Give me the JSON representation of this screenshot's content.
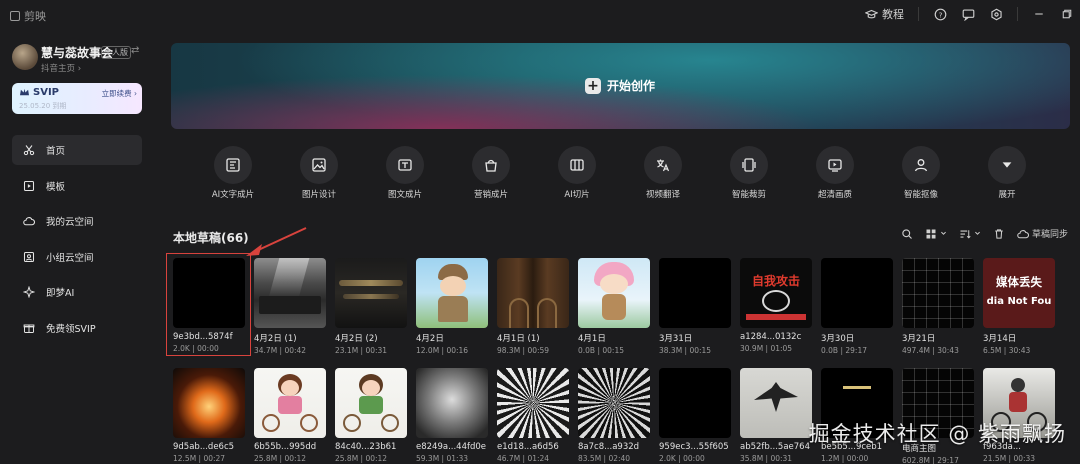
{
  "titlebar": {
    "app_name": "剪映",
    "tutorial_label": "教程"
  },
  "profile": {
    "name": "慧与蕊故事会",
    "badge": "个人版",
    "sub": "抖音主页 ›"
  },
  "svip": {
    "label": "SVIP",
    "cta": "立即续费 ›",
    "sub": "25.05.20 到期"
  },
  "nav": [
    {
      "label": "首页",
      "icon": "scissors-icon",
      "active": true
    },
    {
      "label": "模板",
      "icon": "template-icon",
      "active": false
    },
    {
      "label": "我的云空间",
      "icon": "cloud-space-icon",
      "active": false
    },
    {
      "label": "小组云空间",
      "icon": "team-space-icon",
      "active": false
    },
    {
      "label": "即梦AI",
      "icon": "sparkle-icon",
      "active": false
    },
    {
      "label": "免费领SVIP",
      "icon": "gift-icon",
      "active": false
    }
  ],
  "banner": {
    "create_label": "开始创作"
  },
  "tools": [
    {
      "label": "AI文字成片",
      "icon": "ai-text-video-icon"
    },
    {
      "label": "图片设计",
      "icon": "image-design-icon"
    },
    {
      "label": "图文成片",
      "icon": "image-text-video-icon"
    },
    {
      "label": "营销成片",
      "icon": "marketing-video-icon"
    },
    {
      "label": "AI切片",
      "icon": "ai-slice-icon"
    },
    {
      "label": "视频翻译",
      "icon": "translate-icon"
    },
    {
      "label": "智能裁剪",
      "icon": "smart-crop-icon"
    },
    {
      "label": "超清画质",
      "icon": "hd-quality-icon"
    },
    {
      "label": "智能抠像",
      "icon": "smart-matting-icon"
    },
    {
      "label": "展开",
      "icon": "expand-icon"
    }
  ],
  "drafts": {
    "title": "本地草稿(66)",
    "sync_label": "草稿同步",
    "row1": [
      {
        "name": "9e3bd...5874f",
        "meta": "2.0K | 00:00",
        "thumb": "black"
      },
      {
        "name": "4月2日 (1)",
        "meta": "34.7M | 00:42",
        "thumb": "ink-city"
      },
      {
        "name": "4月2日 (2)",
        "meta": "23.1M | 00:31",
        "thumb": "ink-mountain"
      },
      {
        "name": "4月2日",
        "meta": "12.0M | 00:16",
        "thumb": "cartoon-girl"
      },
      {
        "name": "4月1日 (1)",
        "meta": "98.3M | 00:59",
        "thumb": "doors"
      },
      {
        "name": "4月1日",
        "meta": "0.0B | 00:15",
        "thumb": "pink-girl"
      },
      {
        "name": "3月31日",
        "meta": "38.3M | 00:15",
        "thumb": "black"
      },
      {
        "name": "a1284...0132c",
        "meta": "30.9M | 01:05",
        "thumb": "poster",
        "text": "自我攻击"
      },
      {
        "name": "3月30日",
        "meta": "0.0B | 29:17",
        "thumb": "black"
      },
      {
        "name": "3月21日",
        "meta": "497.4M | 30:43",
        "thumb": "grid-dark"
      },
      {
        "name": "3月14日",
        "meta": "6.5M | 30:43",
        "thumb": "red-title",
        "text": "媒体丢失",
        "text2": "dia Not Fou"
      }
    ],
    "row2": [
      {
        "name": "9d5ab...de6c5",
        "meta": "12.5M | 00:27",
        "thumb": "fire"
      },
      {
        "name": "6b55b...995dd",
        "meta": "25.8M | 00:12",
        "thumb": "kid-bike"
      },
      {
        "name": "84c40...23b61",
        "meta": "25.8M | 00:12",
        "thumb": "kid-bike-2"
      },
      {
        "name": "e8249a...44fd0e",
        "meta": "59.3M | 01:33",
        "thumb": "blur-grey"
      },
      {
        "name": "e1d18...a6d56",
        "meta": "46.7M | 01:24",
        "thumb": "radial"
      },
      {
        "name": "8a7c8...a932d",
        "meta": "83.5M | 02:40",
        "thumb": "radial-2"
      },
      {
        "name": "959ec3...55f605",
        "meta": "2.0K | 00:00",
        "thumb": "black"
      },
      {
        "name": "ab52fb...5ae764",
        "meta": "35.8M | 00:31",
        "thumb": "ink-bird"
      },
      {
        "name": "be5b5...9ceb1",
        "meta": "1.2M | 00:00",
        "thumb": "black-caption"
      },
      {
        "name": "电商主图",
        "meta": "602.8M | 29:17",
        "thumb": "grid-dark"
      },
      {
        "name": "f963da...",
        "meta": "21.5M | 00:33",
        "thumb": "cyclist"
      }
    ]
  },
  "watermark": "掘金技术社区 @ 紫雨飘扬"
}
